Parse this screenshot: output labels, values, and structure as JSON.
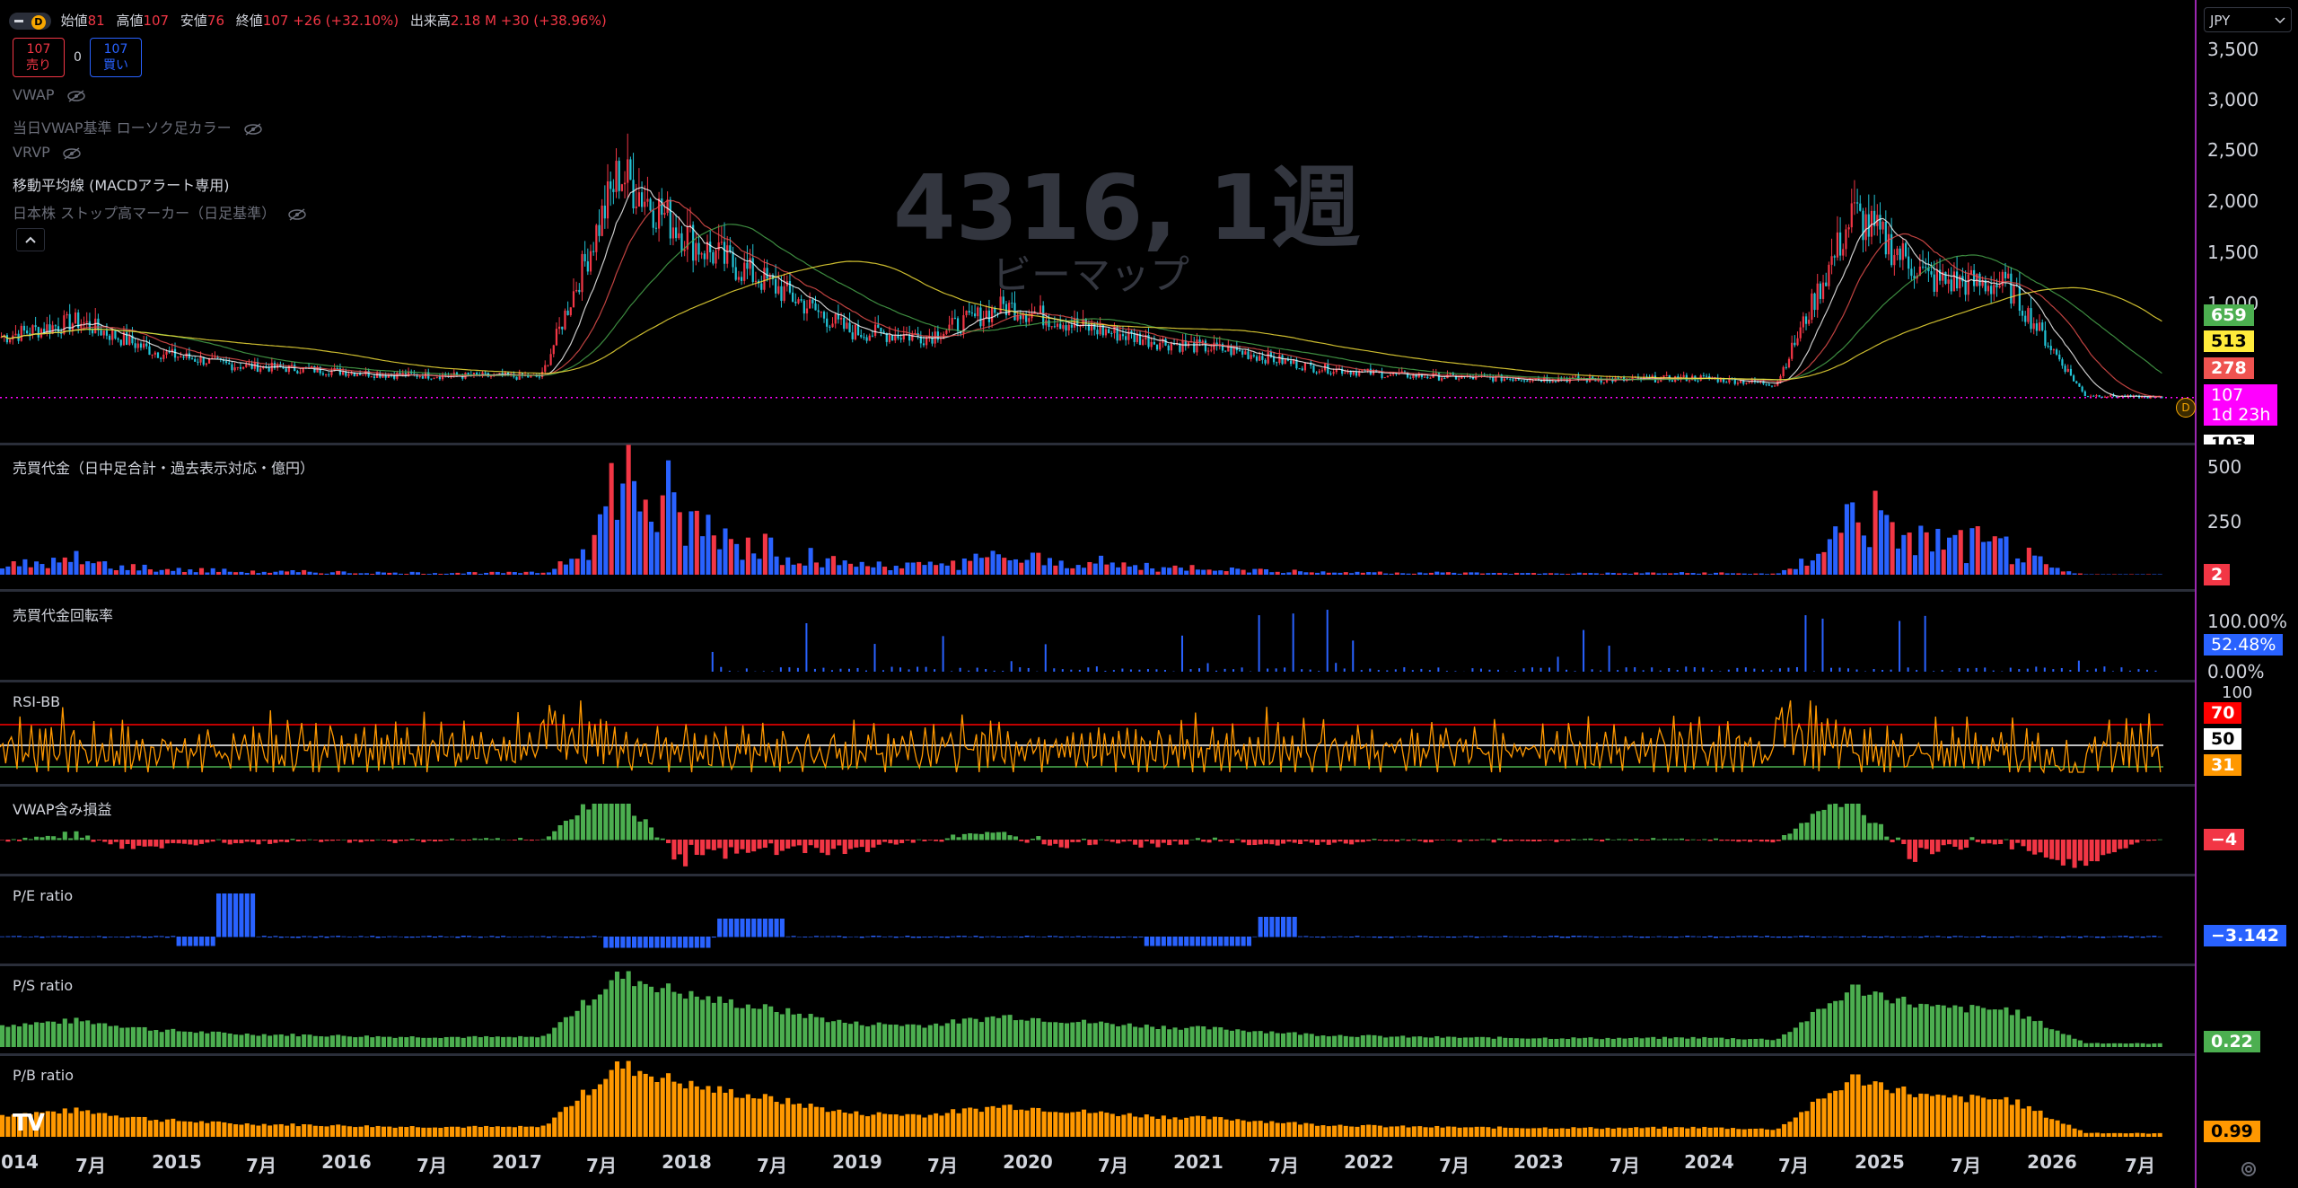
{
  "header": {
    "interval_badge": "D",
    "open_label": "始値",
    "open": "81",
    "high_label": "高値",
    "high": "107",
    "low_label": "安値",
    "low": "76",
    "close_label": "終値",
    "close": "107",
    "change": "+26 (+32.10%)",
    "volume_label": "出来高",
    "volume": "2.18 M",
    "volume_change": "+30 (+38.96%)"
  },
  "trade": {
    "sell_price": "107",
    "sell_label": "売り",
    "spread": "0",
    "buy_price": "107",
    "buy_label": "買い"
  },
  "indicators": [
    {
      "label": "VWAP",
      "hidden": true
    },
    {
      "label": "当日VWAP基準 ローソク足カラー",
      "hidden": true
    },
    {
      "label": "VRVP",
      "hidden": true
    },
    {
      "label": "移動平均線 (MACDアラート専用)",
      "hidden": false
    },
    {
      "label": "日本株 ストップ高マーカー（日足基準）",
      "hidden": true
    }
  ],
  "watermark": {
    "symbol": "4316, 1週",
    "name": "ビーマップ"
  },
  "currency": "JPY",
  "colors": {
    "up": "#f23645",
    "down": "#22c3d6",
    "accent": "#9c27b0",
    "price_line": "#ff00ff"
  },
  "price_axis": {
    "ticks": [
      "3,500",
      "3,000",
      "2,500",
      "2,000",
      "1,500",
      "1,000"
    ],
    "badges": [
      {
        "value": "659",
        "color": "#4caf50"
      },
      {
        "value": "513",
        "color": "#ffeb3b"
      },
      {
        "value": "278",
        "color": "#ef5350"
      },
      {
        "value": "107",
        "sub": "1d 23h",
        "color": "#ff00ff"
      },
      {
        "value": "103",
        "color": "#ffffff"
      }
    ]
  },
  "panes": [
    {
      "id": "turnover",
      "title": "売買代金（日中足合計・過去表示対応・億円）",
      "ticks": [
        "500",
        "250"
      ],
      "badge": "2",
      "badge_color": "#f23645"
    },
    {
      "id": "turnover_rate",
      "title": "売買代金回転率",
      "ticks": [
        "100.00%",
        "0.00%"
      ],
      "badge": "52.48%",
      "badge_color": "#2962ff"
    },
    {
      "id": "rsi",
      "title": "RSI-BB",
      "ticks": [
        "100"
      ],
      "badges": [
        {
          "v": "70",
          "c": "#ff0000"
        },
        {
          "v": "50",
          "c": "#ffffff"
        },
        {
          "v": "31",
          "c": "#ff9800"
        }
      ]
    },
    {
      "id": "vwap_pnl",
      "title": "VWAP含み損益",
      "badge": "−4",
      "badge_color": "#f23645"
    },
    {
      "id": "pe",
      "title": "P/E ratio",
      "badge": "−3.142",
      "badge_color": "#2962ff"
    },
    {
      "id": "ps",
      "title": "P/S ratio",
      "badge": "0.22",
      "badge_color": "#4caf50"
    },
    {
      "id": "pb",
      "title": "P/B ratio",
      "badge": "0.99",
      "badge_color": "#ff9800"
    }
  ],
  "time_axis": [
    "014",
    "7月",
    "2015",
    "7月",
    "2016",
    "7月",
    "2017",
    "7月",
    "2018",
    "7月",
    "2019",
    "7月",
    "2020",
    "7月",
    "2021",
    "7月",
    "2022",
    "7月",
    "2023",
    "7月",
    "2024",
    "7月",
    "2025",
    "7月",
    "2026",
    "7月"
  ],
  "chart_data": {
    "type": "line",
    "title": "4316, 1週",
    "series_name": "ビーマップ",
    "ylim": [
      0,
      3500
    ],
    "x": [
      "2014-01",
      "2014-07",
      "2015-01",
      "2015-07",
      "2016-01",
      "2016-07",
      "2017-01",
      "2017-07",
      "2017-10",
      "2018-01",
      "2018-07",
      "2019-01",
      "2019-07",
      "2020-01",
      "2020-07",
      "2021-01",
      "2021-07",
      "2022-01",
      "2022-07",
      "2023-01",
      "2023-07",
      "2024-01",
      "2024-07",
      "2025-01",
      "2025-07",
      "2025-10",
      "2026-01",
      "2026-04",
      "2026-07"
    ],
    "series": [
      {
        "name": "close",
        "values": [
          700,
          850,
          550,
          420,
          380,
          330,
          320,
          310,
          2300,
          1600,
          1200,
          750,
          700,
          1000,
          800,
          650,
          560,
          400,
          330,
          300,
          290,
          280,
          300,
          240,
          1900,
          1250,
          1200,
          130,
          107
        ]
      }
    ]
  }
}
